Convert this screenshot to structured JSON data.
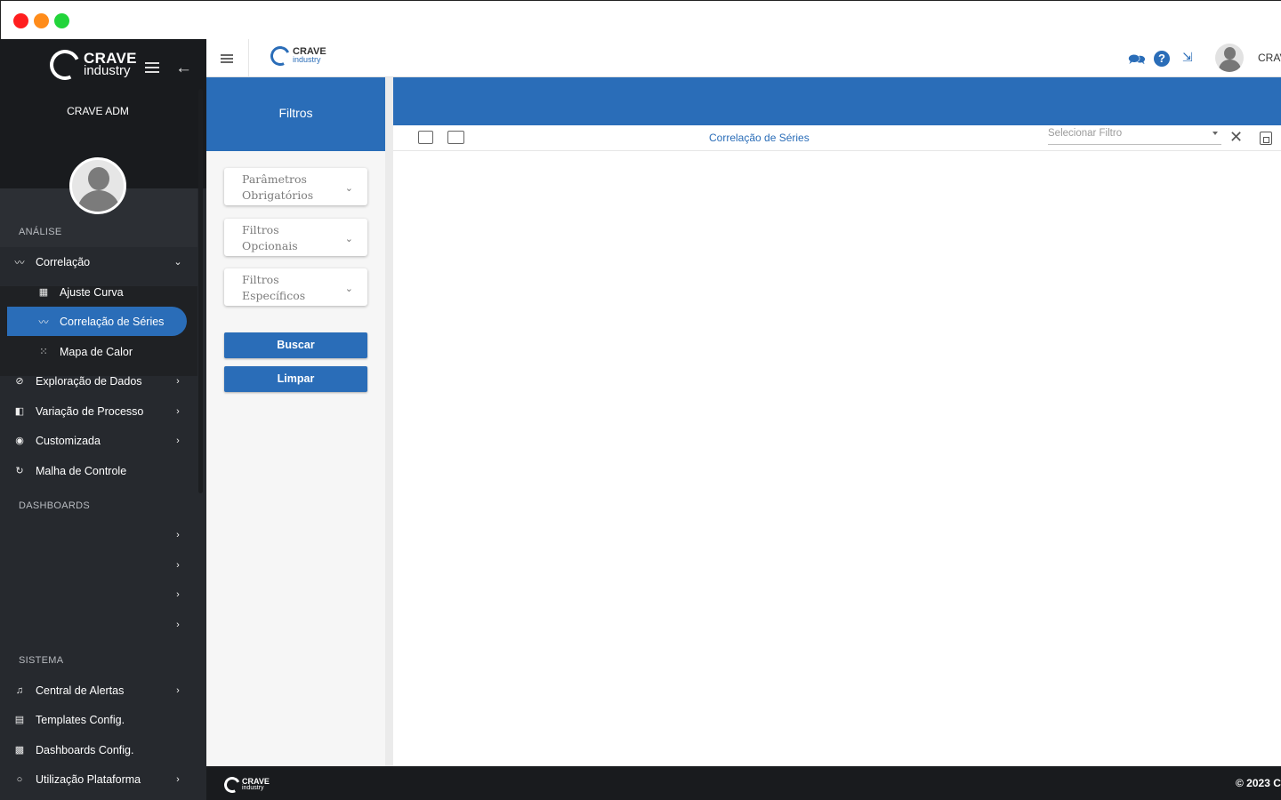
{
  "sidebar": {
    "brand": {
      "line1": "CRAVE",
      "line2": "industry"
    },
    "user_name": "CRAVE ADM",
    "sections": {
      "analise": "ANÁLISE",
      "dashboards": "DASHBOARDS",
      "sistema": "SISTEMA"
    },
    "items": [
      {
        "label": "Correlação",
        "icon": "chart-trend-icon",
        "chevron": "⌄"
      },
      {
        "label": "Ajuste Curva",
        "icon": "grid-icon"
      },
      {
        "label": "Correlação de Séries",
        "icon": "chart-trend-icon",
        "active": true
      },
      {
        "label": "Mapa de Calor",
        "icon": "heatmap-icon"
      },
      {
        "label": "Exploração de Dados",
        "icon": "compass-icon",
        "chevron": "›"
      },
      {
        "label": "Variação de Processo",
        "icon": "process-icon",
        "chevron": "›"
      },
      {
        "label": "Customizada",
        "icon": "palette-icon",
        "chevron": "›"
      },
      {
        "label": "Malha de Controle",
        "icon": "refresh-icon"
      },
      {
        "label": "Central de Alertas",
        "icon": "bell-icon",
        "chevron": "›"
      },
      {
        "label": "Templates Config.",
        "icon": "templates-icon"
      },
      {
        "label": "Dashboards Config.",
        "icon": "dashboards-icon"
      },
      {
        "label": "Utilização Plataforma",
        "icon": "circle-icon",
        "chevron": "›"
      }
    ],
    "dashboard_chevrons": [
      "›",
      "›",
      "›",
      "›"
    ]
  },
  "topbar": {
    "brand": {
      "line1": "CRAVE",
      "line2": "industry"
    },
    "username": "CRAV"
  },
  "filters": {
    "title": "Filtros",
    "accordions": [
      {
        "line1": "Parâmetros",
        "line2": "Obrigatórios"
      },
      {
        "line1": "Filtros",
        "line2": "Opcionais"
      },
      {
        "line1": "Filtros",
        "line2": "Específicos"
      }
    ],
    "search_button": "Buscar",
    "clear_button": "Limpar"
  },
  "card": {
    "title": "Correlação de Séries",
    "select_placeholder": "Selecionar Filtro"
  },
  "footer": {
    "brand": {
      "line1": "CRAVE",
      "line2": "industry"
    },
    "copyright": "© 2023 C"
  },
  "colors": {
    "accent": "#2a6db8",
    "sidebar_bg": "#26292e",
    "sidebar_top": "#191b1e",
    "footer_bg": "#191b1e"
  }
}
